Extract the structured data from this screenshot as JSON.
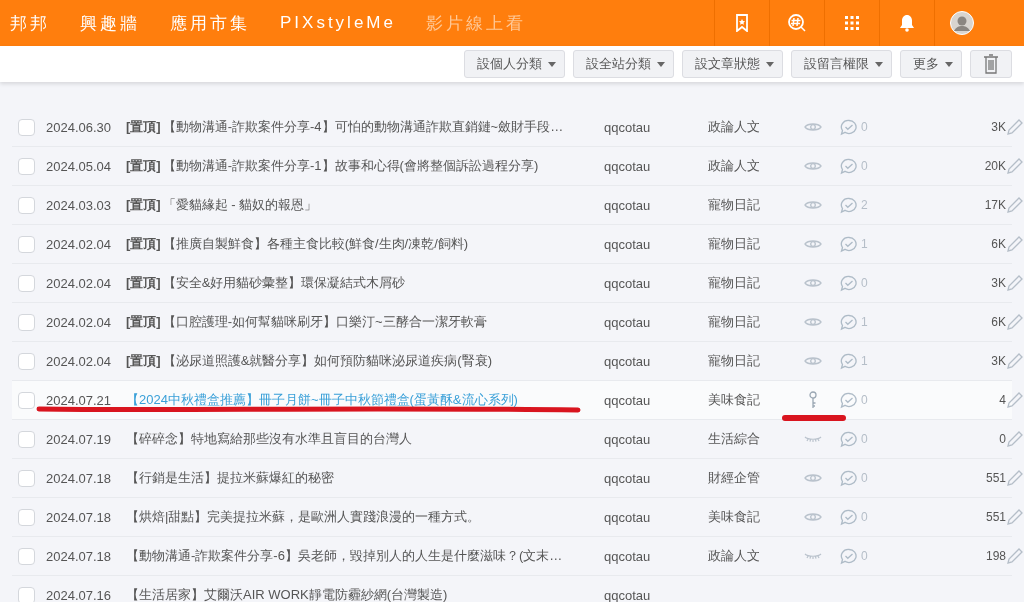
{
  "nav": {
    "items": [
      {
        "label": "邦邦",
        "faded": false
      },
      {
        "label": "興趣牆",
        "faded": false
      },
      {
        "label": "應用市集",
        "faded": false
      },
      {
        "label": "PIXstyleMe",
        "faded": false
      },
      {
        "label": "影片線上看",
        "faded": true
      }
    ],
    "icons": [
      {
        "kind": "bookmark"
      },
      {
        "kind": "hashtag"
      },
      {
        "kind": "apps"
      },
      {
        "kind": "bell"
      },
      {
        "kind": "avatar"
      }
    ]
  },
  "toolbar": {
    "buttons": [
      "設個人分類",
      "設全站分類",
      "設文章狀態",
      "設留言權限",
      "更多"
    ]
  },
  "rows": [
    {
      "date": "2024.06.30",
      "pin": "[置頂]",
      "title": "【動物溝通-詐欺案件分享-4】可怕的動物溝通詐欺直銷鏈~斂財手段…",
      "author": "qqcotau",
      "category": "政論人文",
      "kind": "eye",
      "comments": "0",
      "views": "3K",
      "hovered": false,
      "annotated": false
    },
    {
      "date": "2024.05.04",
      "pin": "[置頂]",
      "title": "【動物溝通-詐欺案件分享-1】故事和心得(會將整個訴訟過程分享)",
      "author": "qqcotau",
      "category": "政論人文",
      "kind": "eye",
      "comments": "0",
      "views": "20K",
      "hovered": false,
      "annotated": false
    },
    {
      "date": "2024.03.03",
      "pin": "[置頂]",
      "title": "「愛貓緣起 - 貓奴的報恩」",
      "author": "qqcotau",
      "category": "寵物日記",
      "kind": "eye",
      "comments": "2",
      "views": "17K",
      "hovered": false,
      "annotated": false
    },
    {
      "date": "2024.02.04",
      "pin": "[置頂]",
      "title": "【推廣自製鮮食】各種主食比較(鮮食/生肉/凍乾/飼料)",
      "author": "qqcotau",
      "category": "寵物日記",
      "kind": "eye",
      "comments": "1",
      "views": "6K",
      "hovered": false,
      "annotated": false
    },
    {
      "date": "2024.02.04",
      "pin": "[置頂]",
      "title": "【安全&好用貓砂彙整】環保凝結式木屑砂",
      "author": "qqcotau",
      "category": "寵物日記",
      "kind": "eye",
      "comments": "0",
      "views": "3K",
      "hovered": false,
      "annotated": false
    },
    {
      "date": "2024.02.04",
      "pin": "[置頂]",
      "title": "【口腔護理-如何幫貓咪刷牙】口樂汀~三酵合一潔牙軟膏",
      "author": "qqcotau",
      "category": "寵物日記",
      "kind": "eye",
      "comments": "1",
      "views": "6K",
      "hovered": false,
      "annotated": false
    },
    {
      "date": "2024.02.04",
      "pin": "[置頂]",
      "title": "【泌尿道照護&就醫分享】如何預防貓咪泌尿道疾病(腎衰)",
      "author": "qqcotau",
      "category": "寵物日記",
      "kind": "eye",
      "comments": "1",
      "views": "3K",
      "hovered": false,
      "annotated": false
    },
    {
      "date": "2024.07.21",
      "title": "【2024中秋禮盒推薦】冊子月餅~冊子中秋節禮盒(蛋黃酥&流心系列)",
      "author": "qqcotau",
      "category": "美味食記",
      "kind": "key",
      "comments": "0",
      "views": "4",
      "hovered": true,
      "annotated": true
    },
    {
      "date": "2024.07.19",
      "title": "【碎碎念】特地寫給那些沒有水準且盲目的台灣人",
      "author": "qqcotau",
      "category": "生活綜合",
      "kind": "closed",
      "comments": "0",
      "views": "0",
      "hovered": false,
      "annotated": false
    },
    {
      "date": "2024.07.18",
      "title": "【行銷是生活】提拉米蘇爆紅的秘密",
      "author": "qqcotau",
      "category": "財經企管",
      "kind": "eye",
      "comments": "0",
      "views": "551",
      "hovered": false,
      "annotated": false
    },
    {
      "date": "2024.07.18",
      "title": "【烘焙|甜點】完美提拉米蘇，是歐洲人實踐浪漫的一種方式。",
      "author": "qqcotau",
      "category": "美味食記",
      "kind": "eye",
      "comments": "0",
      "views": "551",
      "hovered": false,
      "annotated": false
    },
    {
      "date": "2024.07.18",
      "title": "【動物溝通-詐欺案件分享-6】吳老師，毀掉別人的人生是什麼滋味？(文末…",
      "author": "qqcotau",
      "category": "政論人文",
      "kind": "closed",
      "comments": "0",
      "views": "198",
      "hovered": false,
      "annotated": false
    },
    {
      "date": "2024.07.16",
      "title": "【生活居家】艾爾沃AIR WORK靜電防霾紗網(台灣製造)",
      "author": "qqcotau",
      "hovered": false,
      "annotated": false
    }
  ]
}
